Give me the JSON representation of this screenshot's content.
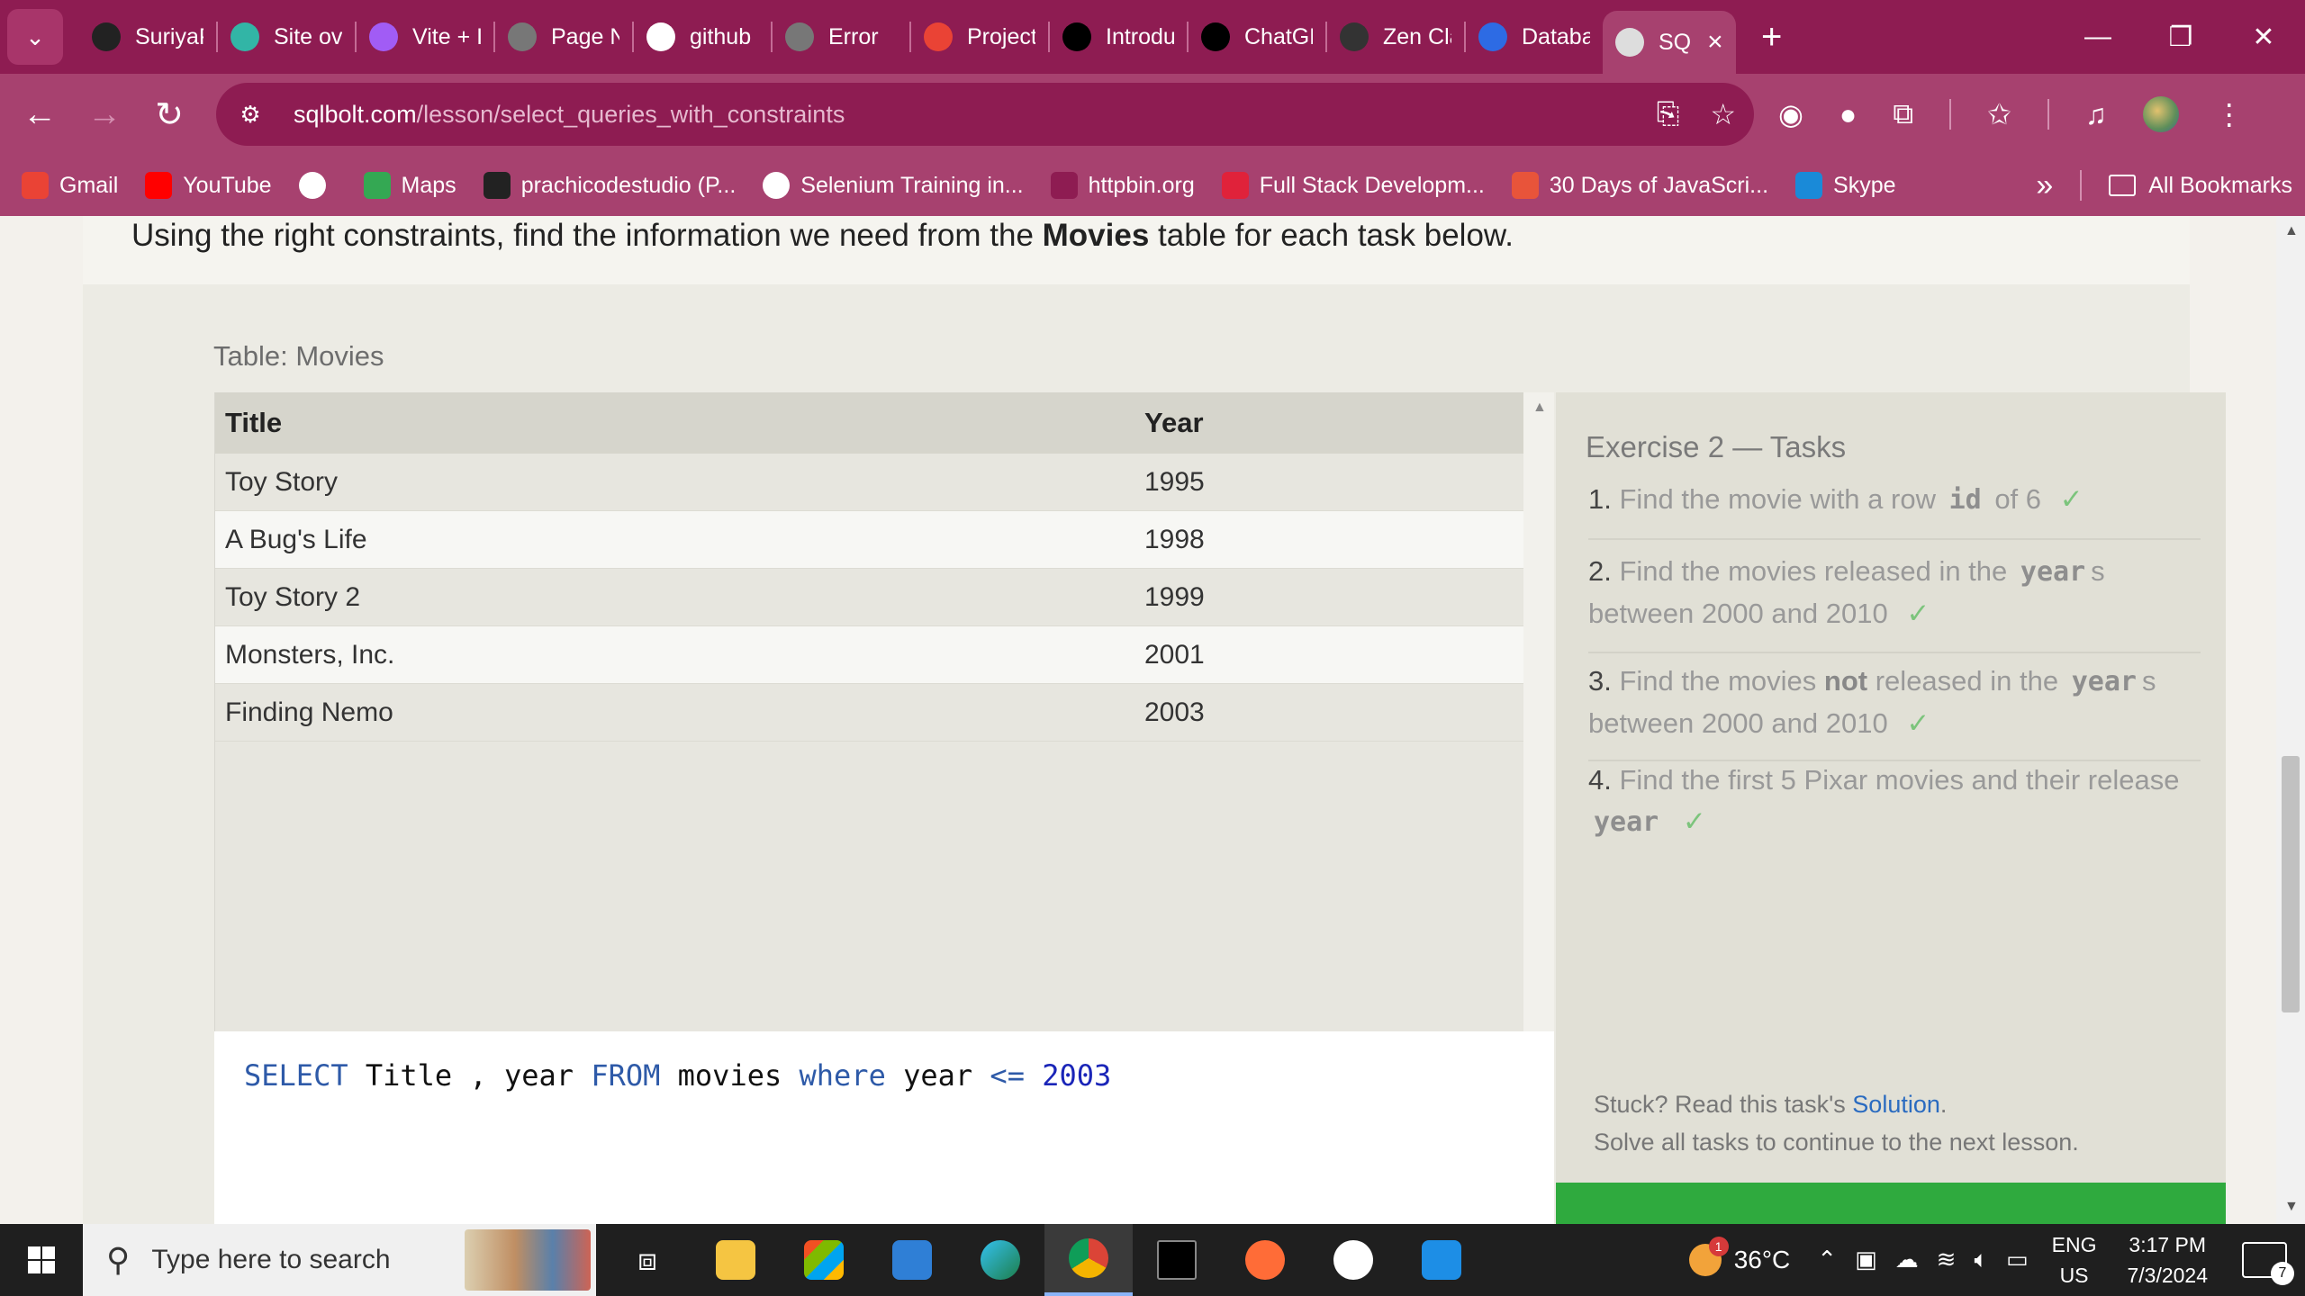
{
  "browser": {
    "tabs": [
      {
        "label": "SuriyaP",
        "icon": "github-icon",
        "color": "#222222"
      },
      {
        "label": "Site ov",
        "icon": "netlify-icon",
        "color": "#32b5a6"
      },
      {
        "label": "Vite + I",
        "icon": "vite-icon",
        "color": "#a15cf5"
      },
      {
        "label": "Page N",
        "icon": "globe-icon",
        "color": "#777777"
      },
      {
        "label": "github",
        "icon": "google-icon",
        "color": "#ffffff"
      },
      {
        "label": "Error",
        "icon": "globe-icon",
        "color": "#777777"
      },
      {
        "label": "Project",
        "icon": "gmail-icon",
        "color": "#ea4335"
      },
      {
        "label": "Introdu",
        "icon": "openai-icon",
        "color": "#000000"
      },
      {
        "label": "ChatGP",
        "icon": "openai-icon",
        "color": "#000000"
      },
      {
        "label": "Zen Cla",
        "icon": "zen-icon",
        "color": "#333333"
      },
      {
        "label": "Databa",
        "icon": "zm-icon",
        "color": "#2d6be4"
      },
      {
        "label": "SQ",
        "icon": "database-icon",
        "color": "#dddddd"
      }
    ],
    "url_host": "sqlbolt.com",
    "url_path": "/lesson/select_queries_with_constraints",
    "bookmarks": [
      {
        "label": "Gmail",
        "icon": "gmail-icon",
        "color": "#ea4335"
      },
      {
        "label": "YouTube",
        "icon": "youtube-icon",
        "color": "#ff0000"
      },
      {
        "label": "",
        "icon": "globe-icon",
        "color": "#ffffff"
      },
      {
        "label": "Maps",
        "icon": "maps-icon",
        "color": "#34a853"
      },
      {
        "label": "prachicodestudio (P...",
        "icon": "github-icon",
        "color": "#222222"
      },
      {
        "label": "Selenium Training in...",
        "icon": "globe-icon",
        "color": "#ffffff"
      },
      {
        "label": "httpbin.org",
        "icon": "httpbin-icon",
        "color": "#8e1c52"
      },
      {
        "label": "Full Stack Developm...",
        "icon": "shield-icon",
        "color": "#e0223a"
      },
      {
        "label": "30 Days of JavaScri...",
        "icon": "js-icon",
        "color": "#e8543a"
      },
      {
        "label": "Skype",
        "icon": "skype-icon",
        "color": "#1a8ad8"
      }
    ],
    "all_bookmarks": "All Bookmarks"
  },
  "lesson": {
    "intro_prefix": "Using the right constraints, find the information we need from the ",
    "intro_bold": "Movies",
    "intro_suffix": " table for each task below.",
    "table_caption": "Table: Movies",
    "columns": [
      "Title",
      "Year"
    ],
    "rows": [
      [
        "Toy Story",
        "1995"
      ],
      [
        "A Bug's Life",
        "1998"
      ],
      [
        "Toy Story 2",
        "1999"
      ],
      [
        "Monsters, Inc.",
        "2001"
      ],
      [
        "Finding Nemo",
        "2003"
      ]
    ],
    "query": {
      "kw_select": "SELECT",
      "cols": " Title , year ",
      "kw_from": "FROM",
      "table": " movies ",
      "kw_where": "where",
      "col": " year ",
      "op": "<=",
      "sp": " ",
      "value": "2003"
    },
    "exercise_title": "Exercise 2 — Tasks",
    "tasks": {
      "t1": {
        "num": "1.",
        "pre": "Find the movie with a row ",
        "code": "id",
        "post": " of 6",
        "check": "✓"
      },
      "t2": {
        "num": "2.",
        "pre": "Find the movies released in the ",
        "code": "year",
        "post": "s between 2000 and 2010",
        "check": "✓"
      },
      "t3": {
        "num": "3.",
        "pre": "Find the movies ",
        "bold": "not",
        "mid": " released in the ",
        "code": "year",
        "post": "s between 2000 and 2010",
        "check": "✓"
      },
      "t4": {
        "num": "4.",
        "pre": "Find the first 5 Pixar movies and their release ",
        "code": "year",
        "check": "✓"
      }
    },
    "stuck_prefix": "Stuck? Read this task's ",
    "stuck_link": "Solution",
    "stuck_period": ".",
    "continue_note": "Solve all tasks to continue to the next lesson."
  },
  "taskbar": {
    "search_placeholder": "Type here to search",
    "weather_temp": "36°C",
    "weather_badge": "1",
    "lang": "ENG",
    "region": "US",
    "time": "3:17 PM",
    "date": "7/3/2024",
    "notifications": "7"
  }
}
